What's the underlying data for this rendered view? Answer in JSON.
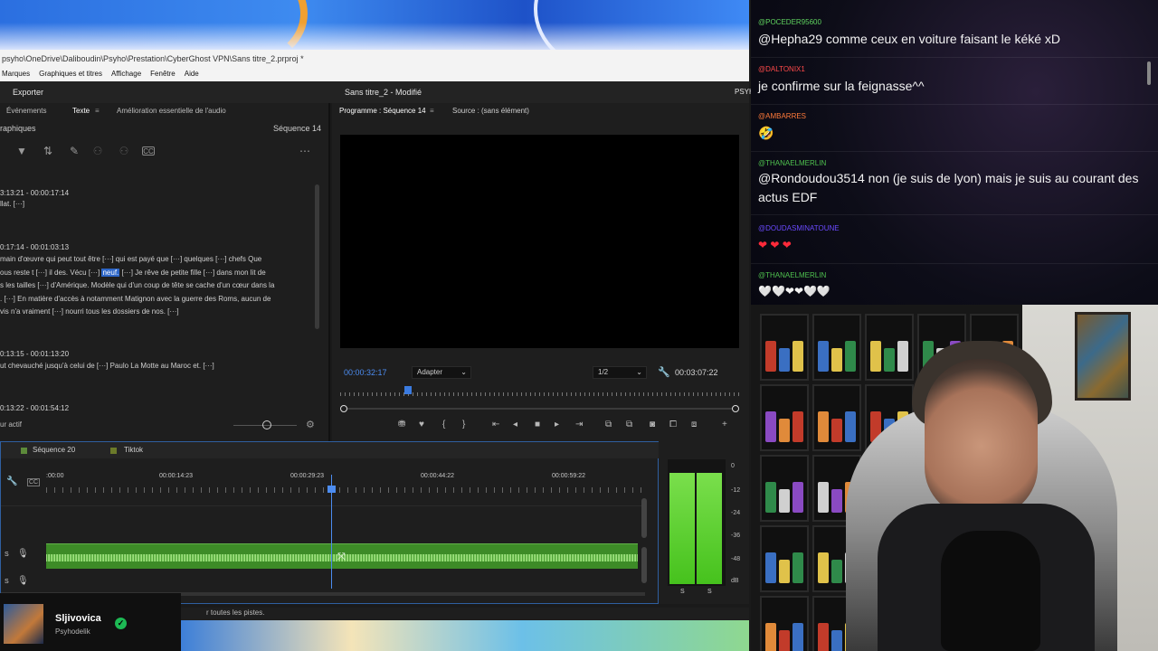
{
  "window": {
    "path": "psyho\\OneDrive\\Daliboudin\\Psyho\\Prestation\\CyberGhost VPN\\Sans titre_2.prproj *",
    "menu": [
      "Marques",
      "Graphiques et titres",
      "Affichage",
      "Fenêtre",
      "Aide"
    ],
    "export_label": "Exporter",
    "project_title": "Sans titre_2 - Modifié",
    "workspace_label": "PSYH"
  },
  "left_panel": {
    "tabs": [
      "Événements",
      "Texte",
      "Amélioration essentielle de l'audio"
    ],
    "section_label": "raphiques",
    "sequence_label": "Séquence 14",
    "transcript": [
      {
        "timecode": "3:13:21 - 00:00:17:14",
        "lines": [
          "llat. [···]"
        ]
      },
      {
        "timecode": "0:17:14 - 00:01:03:13",
        "lines": [
          "main d'œuvre qui peut tout être [···] qui est payé que [···] quelques [···] chefs Que",
          "ous reste t [···] il des. Vécu [···]",
          "s les tailles [···] d'Amérique. Modèle qui d'un coup de tête se cache d'un cœur dans la",
          ". [···] En matière d'accès à notamment Matignon avec la guerre des Roms, aucun de",
          "vis n'a vraiment [···] nourri tous les dossiers de nos. [···]"
        ],
        "highlight_word": "neuf.",
        "line2_after": "[···] Je rêve de petite fille [···] dans mon lit de"
      },
      {
        "timecode": "0:13:15 - 00:01:13:20",
        "lines": [
          "ut chevauché jusqu'à celui de [···] Paulo La Motte au Maroc et. [···]"
        ]
      },
      {
        "timecode": "0:13:22 - 00:01:54:12",
        "lines": []
      }
    ],
    "footer_label": "ur actif"
  },
  "program_monitor": {
    "tab_program": "Programme : Séquence 14",
    "tab_source": "Source : (sans élément)",
    "current_time": "00:00:32:17",
    "fit_option": "Adapter",
    "resolution_option": "1/2",
    "duration": "00:03:07:22",
    "playhead_progress": 0.17
  },
  "timeline": {
    "tabs": [
      "Séquence 20",
      "Tiktok"
    ],
    "tab_colors": [
      "#5c8a3a",
      "#6b7a2a"
    ],
    "ruler": [
      ":00:00",
      "00:00:14:23",
      "00:00:29:23",
      "00:00:44:22",
      "00:00:59:22"
    ],
    "track_label_s": "S",
    "status_text": "r toutes les pistes."
  },
  "audio_meter": {
    "scale": [
      "0",
      "-12",
      "-24",
      "-36",
      "-48",
      "dB"
    ],
    "channel_labels": [
      "S",
      "S"
    ],
    "levels": [
      0.88,
      0.88
    ]
  },
  "spotify": {
    "title": "Sljivovica",
    "artist": "Psyhodelik"
  },
  "chat": [
    {
      "user": "@POCEDER95600",
      "color": "#5fd35f",
      "text": "@Hepha29 comme ceux en voiture faisant le kéké xD"
    },
    {
      "user": "@DALTONIX1",
      "color": "#ff4a4a",
      "text": "je confirme sur la feignasse^^"
    },
    {
      "user": "@AMBARRES",
      "color": "#ff7a3a",
      "text": "🤣"
    },
    {
      "user": "@THANAELMERLIN",
      "color": "#4fc24f",
      "text": "@Rondoudou3514 non (je suis de lyon) mais je suis au courant des actus EDF"
    },
    {
      "user": "@DOUDASMINATOUNE",
      "color": "#6a4aff",
      "text": "❤ ❤ ❤"
    },
    {
      "user": "@THANAELMERLIN",
      "color": "#4fc24f",
      "text": "🤍🤍❤❤🤍🤍"
    }
  ]
}
